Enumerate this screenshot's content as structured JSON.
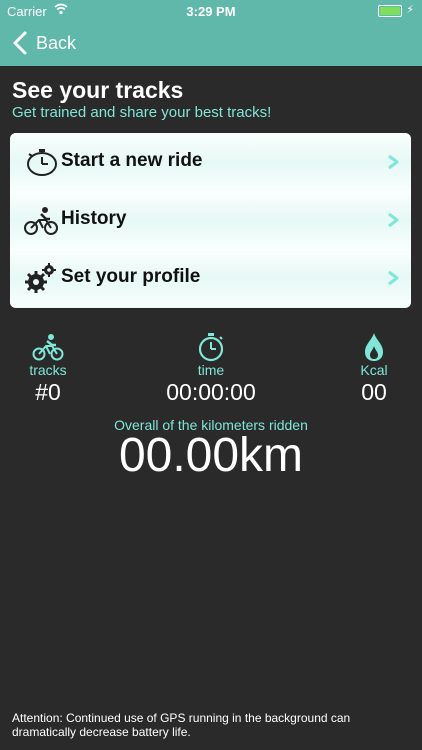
{
  "status_bar": {
    "carrier": "Carrier",
    "time": "3:29 PM"
  },
  "nav": {
    "back_label": "Back"
  },
  "header": {
    "title": "See your tracks",
    "subtitle": "Get trained and share your best tracks!"
  },
  "menu": {
    "items": [
      {
        "label": "Start a new ride",
        "icon": "stopwatch-icon"
      },
      {
        "label": "History",
        "icon": "cyclist-icon"
      },
      {
        "label": "Set your profile",
        "icon": "gears-icon"
      }
    ]
  },
  "stats": {
    "tracks": {
      "label": "tracks",
      "value": "#0",
      "icon": "cyclist-icon"
    },
    "time": {
      "label": "time",
      "value": "00:00:00",
      "icon": "stopwatch-icon"
    },
    "kcal": {
      "label": "Kcal",
      "value": "00",
      "icon": "flame-icon"
    }
  },
  "overall": {
    "label": "Overall of the kilometers ridden",
    "value": "00.00km"
  },
  "footer": {
    "text": "Attention: Continued use of GPS running in the background can dramatically decrease battery life."
  },
  "colors": {
    "accent": "#5fb8aa",
    "accent_text": "#7fe7d7",
    "background": "#2a2a2a"
  }
}
